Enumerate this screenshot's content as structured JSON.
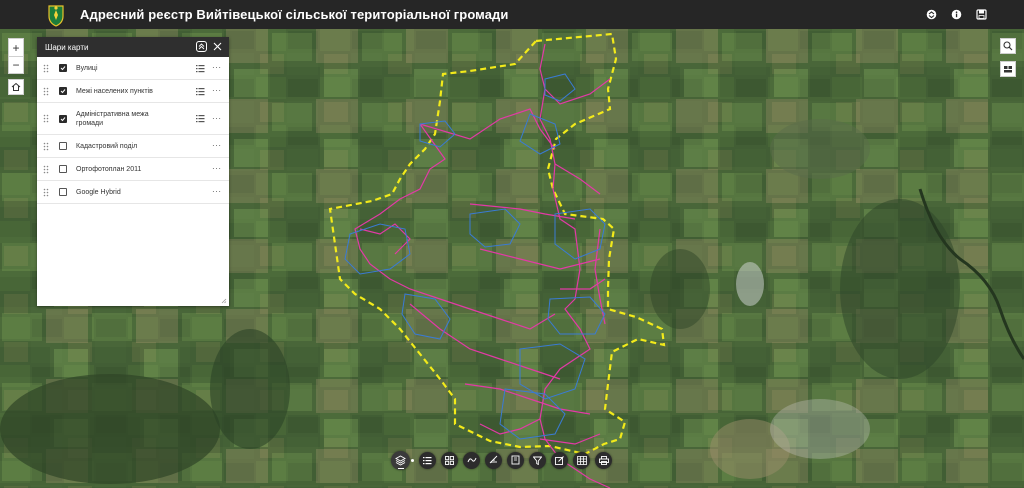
{
  "header": {
    "title": "Адресний реєстр Вийтівецької сільської територіальної громади",
    "tools": [
      {
        "icon": "switch-icon"
      },
      {
        "icon": "info-icon"
      },
      {
        "icon": "save-icon"
      }
    ]
  },
  "map_controls": {
    "zoom_in": "+",
    "zoom_out": "−",
    "home_icon": "home-icon"
  },
  "layers_panel": {
    "title": "Шари карти",
    "layers": [
      {
        "label": "Вулиці",
        "checked": true,
        "has_legend": true
      },
      {
        "label": "Межі населених пунктів",
        "checked": true,
        "has_legend": true
      },
      {
        "label": "Адміністративна межа громади",
        "checked": true,
        "has_legend": true
      },
      {
        "label": "Кадастровий поділ",
        "checked": false,
        "has_legend": false
      },
      {
        "label": "Ортофотоплан 2011",
        "checked": false,
        "has_legend": false
      },
      {
        "label": "Google Hybrid",
        "checked": false,
        "has_legend": false
      }
    ],
    "more_label": "···"
  },
  "right_tools": [
    "search-icon",
    "basemap-icon"
  ],
  "bottom_toolbar": [
    "layers-icon",
    "list-icon",
    "grid-icon",
    "draw-icon",
    "measure-icon",
    "bookmark-icon",
    "filter-icon",
    "edit-icon",
    "table-icon",
    "print-icon"
  ],
  "colors": {
    "header_bg": "#262626",
    "boundary": "#f2ea1a",
    "streets": "#e23aa6",
    "settlements": "#3a7bd5"
  }
}
